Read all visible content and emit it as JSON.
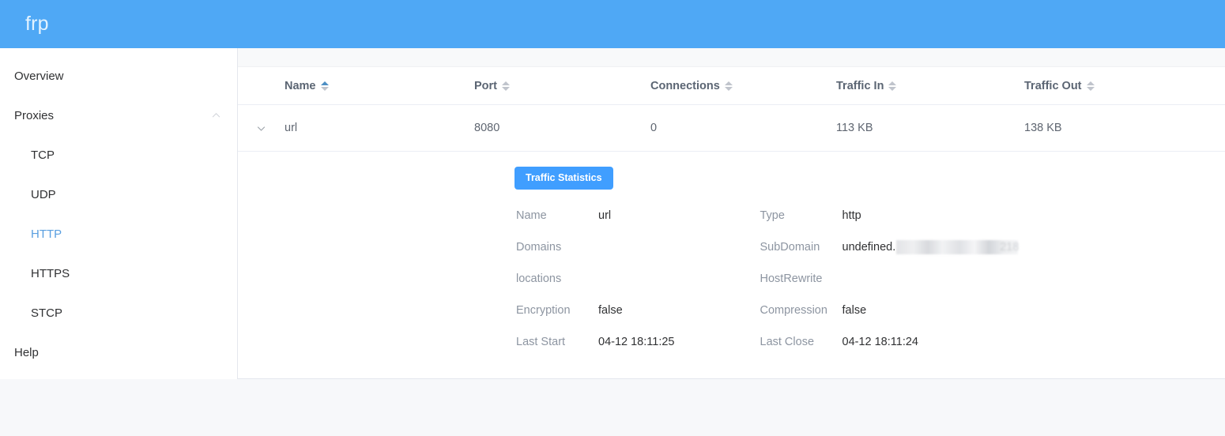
{
  "header": {
    "brand": "frp",
    "brand_color": "#4fa8f5"
  },
  "sidebar": {
    "items": [
      {
        "label": "Overview",
        "level": "top",
        "active": false,
        "icon": ""
      },
      {
        "label": "Proxies",
        "level": "top",
        "active": false,
        "icon": "chevron-up-icon"
      },
      {
        "label": "TCP",
        "level": "sub",
        "active": false,
        "icon": ""
      },
      {
        "label": "UDP",
        "level": "sub",
        "active": false,
        "icon": ""
      },
      {
        "label": "HTTP",
        "level": "sub",
        "active": true,
        "icon": ""
      },
      {
        "label": "HTTPS",
        "level": "sub",
        "active": false,
        "icon": ""
      },
      {
        "label": "STCP",
        "level": "sub",
        "active": false,
        "icon": ""
      },
      {
        "label": "Help",
        "level": "top",
        "active": false,
        "icon": ""
      }
    ],
    "active_color": "#5a9fe0"
  },
  "table": {
    "columns": [
      {
        "label": "Name",
        "sort": "asc",
        "sort_icon": "sort-caret-icon"
      },
      {
        "label": "Port",
        "sort": "none",
        "sort_icon": "sort-caret-icon"
      },
      {
        "label": "Connections",
        "sort": "none",
        "sort_icon": "sort-caret-icon"
      },
      {
        "label": "Traffic In",
        "sort": "none",
        "sort_icon": "sort-caret-icon"
      },
      {
        "label": "Traffic Out",
        "sort": "none",
        "sort_icon": "sort-caret-icon"
      }
    ],
    "rows": [
      {
        "expand_icon": "chevron-down-icon",
        "expanded": true,
        "name": "url",
        "port": "8080",
        "connections": "0",
        "traffic_in": "113 KB",
        "traffic_out": "138 KB"
      }
    ]
  },
  "detail": {
    "button": {
      "label": "Traffic Statistics",
      "color": "#409eff"
    },
    "left": [
      {
        "key": "Name",
        "value": "url"
      },
      {
        "key": "Domains",
        "value": ""
      },
      {
        "key": "locations",
        "value": ""
      },
      {
        "key": "Encryption",
        "value": "false"
      },
      {
        "key": "Last Start",
        "value": "04-12 18:11:25"
      }
    ],
    "right": [
      {
        "key": "Type",
        "value": "http"
      },
      {
        "key": "SubDomain",
        "value": "undefined.",
        "redacted": true,
        "redacted_tail": "218"
      },
      {
        "key": "HostRewrite",
        "value": ""
      },
      {
        "key": "Compression",
        "value": "false"
      },
      {
        "key": "Last Close",
        "value": "04-12 18:11:24"
      }
    ]
  }
}
